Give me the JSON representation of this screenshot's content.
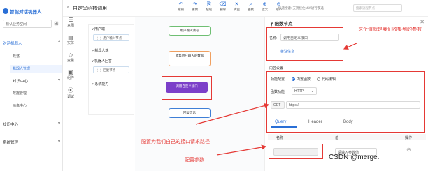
{
  "app": {
    "name": "智能对话机器人",
    "workspace": "默认业务空间",
    "back": "‹",
    "page_title": "自定义函数调用"
  },
  "nav": {
    "sections": [
      {
        "label": "对话机器人",
        "expand": "^",
        "items": [
          "概述",
          "机器人管理"
        ],
        "active": "机器人管理"
      },
      {
        "label": "知识中心",
        "expand": "v"
      },
      {
        "label": "数据管理",
        "expand": ""
      },
      {
        "label": "画像中心",
        "expand": ""
      },
      {
        "label": "知识中心",
        "expand": "v"
      },
      {
        "label": "系统管理",
        "expand": "v"
      }
    ]
  },
  "iconbar": [
    {
      "icon": "☰",
      "label": "意图"
    },
    {
      "icon": "▤",
      "label": "实体"
    },
    {
      "icon": "◇",
      "label": "变量"
    },
    {
      "icon": "▣",
      "label": "组件"
    },
    {
      "icon": "⦿",
      "label": "调试"
    }
  ],
  "toolbar": [
    {
      "icon": "↶",
      "label": "撤销"
    },
    {
      "icon": "↷",
      "label": "重做"
    },
    {
      "icon": "⎘",
      "label": "粘贴"
    },
    {
      "icon": "⌫",
      "label": "删除"
    },
    {
      "icon": "✕",
      "label": "清空"
    },
    {
      "icon": "⌕",
      "label": "查找"
    },
    {
      "icon": "⊕",
      "label": "放大"
    },
    {
      "icon": "⊖",
      "label": "缩小"
    }
  ],
  "hint": "快速搜索: 支持按住shift进行多选",
  "search_placeholder": "搜索流程节点",
  "panel": {
    "groups": [
      {
        "label": "用户端",
        "arrow": "v",
        "nodes": [
          "用户输入节点"
        ]
      },
      {
        "label": "机器人端",
        "arrow": ">",
        "nodes": []
      },
      {
        "label": "机器人回答",
        "arrow": "v",
        "nodes": [
          "回复节点"
        ]
      },
      {
        "label": "系统能力",
        "arrow": ">",
        "nodes": []
      }
    ]
  },
  "flow": {
    "nodes": [
      "用户输入请号",
      "收集用户输入的数据",
      "调用自定义接口",
      "回复信息"
    ]
  },
  "props": {
    "section_title": "函数节点",
    "name_label": "名称:",
    "name_value": "调用自定义接口",
    "desc_link": "备注信息",
    "content_title": "内容设置",
    "func_type_label": "功能配置:",
    "func_type_options": [
      "内置函数",
      "代码编辑"
    ],
    "method_label": "函数功能:",
    "method_value": "HTTP",
    "method_verb": "GET",
    "url_value": "https://",
    "tabs": [
      "Query",
      "Header",
      "Body"
    ],
    "table_headers": [
      "名称",
      "值",
      "操作"
    ],
    "row_value_hint": "请输入参数值"
  },
  "annotations": {
    "collect": "这个值就是我们收集到的参数",
    "path": "配置为我们自己的接口请求路径",
    "params": "配置参数"
  },
  "watermark": "CSDN @merge."
}
